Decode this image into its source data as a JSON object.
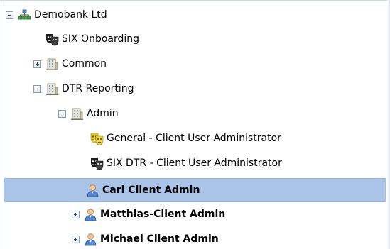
{
  "tree": {
    "nodes": [
      {
        "label": "Demobank Ltd",
        "icon": "org-structure-icon",
        "toggle": "minus",
        "bold": false,
        "selected": false
      },
      {
        "label": "SIX Onboarding",
        "icon": "theater-masks-dark-icon",
        "toggle": "none",
        "bold": false,
        "selected": false
      },
      {
        "label": "Common",
        "icon": "building-icon",
        "toggle": "plus",
        "bold": false,
        "selected": false
      },
      {
        "label": "DTR Reporting",
        "icon": "building-icon",
        "toggle": "minus",
        "bold": false,
        "selected": false
      },
      {
        "label": "Admin",
        "icon": "building-icon",
        "toggle": "minus",
        "bold": false,
        "selected": false
      },
      {
        "label": "General - Client User Administrator",
        "icon": "theater-masks-yellow-icon",
        "toggle": "none",
        "bold": false,
        "selected": false
      },
      {
        "label": "SIX DTR - Client User Administrator",
        "icon": "theater-masks-dark-icon",
        "toggle": "none",
        "bold": false,
        "selected": false
      },
      {
        "label": "Carl Client Admin",
        "icon": "user-icon",
        "toggle": "none",
        "bold": true,
        "selected": true
      },
      {
        "label": "Matthias-Client Admin",
        "icon": "user-icon",
        "toggle": "plus",
        "bold": true,
        "selected": false
      },
      {
        "label": "Michael Client Admin",
        "icon": "user-icon",
        "toggle": "plus",
        "bold": true,
        "selected": false
      }
    ]
  },
  "colors": {
    "selection": "#a9c4e6",
    "border": "#a9c1da"
  }
}
